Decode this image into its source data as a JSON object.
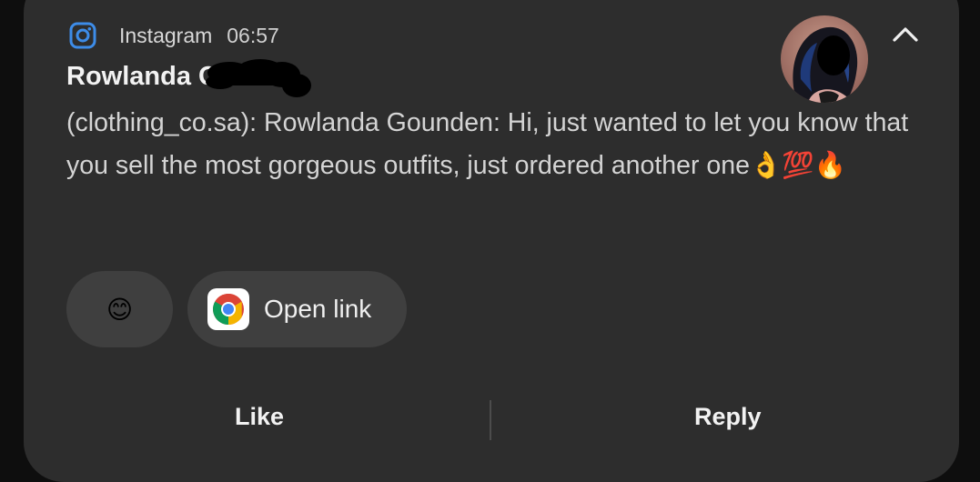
{
  "notification": {
    "app_name": "Instagram",
    "time": "06:57",
    "sender": "Rowlanda G",
    "message": "(clothing_co.sa): Rowlanda Gounden: Hi, just wanted to let you know that you sell the most gorgeous outfits, just ordered another one👌💯🔥",
    "icons": {
      "app": "instagram-icon",
      "collapse": "chevron-up-icon",
      "avatar": "profile-avatar",
      "chrome": "chrome-icon"
    },
    "colors": {
      "card_background": "#2d2d2d",
      "chip_background": "#3f3f3f",
      "instagram_blue": "#3d8ce8"
    }
  },
  "smart_replies": {
    "emoji": "😊",
    "open_link": "Open link"
  },
  "actions": {
    "like": "Like",
    "reply": "Reply"
  }
}
